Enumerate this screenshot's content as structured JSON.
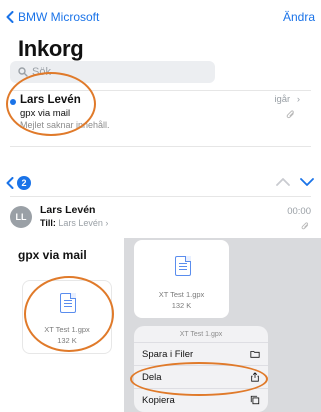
{
  "top_nav": {
    "back_label": "BMW Microsoft",
    "edit_label": "Ändra"
  },
  "title": "Inkorg",
  "search": {
    "placeholder": "Sök"
  },
  "mail_list": {
    "items": [
      {
        "sender": "Lars Levén",
        "subject": "gpx via mail",
        "preview": "Mejlet saknar innehåll.",
        "when": "igår"
      }
    ]
  },
  "message_toolbar": {
    "badge_count": "2"
  },
  "message": {
    "avatar_initials": "LL",
    "sender": "Lars Levén",
    "to_label": "Till:",
    "to_value": "Lars Levén",
    "time": "00:00",
    "subject": "gpx via mail"
  },
  "attachment": {
    "filename": "XT Test 1.gpx",
    "size": "132 K"
  },
  "context_menu": {
    "header": "XT Test 1.gpx",
    "items": [
      {
        "label": "Spara i Filer",
        "icon": "folder-icon"
      },
      {
        "label": "Dela",
        "icon": "share-icon"
      },
      {
        "label": "Kopiera",
        "icon": "copy-icon"
      }
    ]
  },
  "colors": {
    "accent": "#1a73e8",
    "highlight_ring": "#e07a2a"
  }
}
